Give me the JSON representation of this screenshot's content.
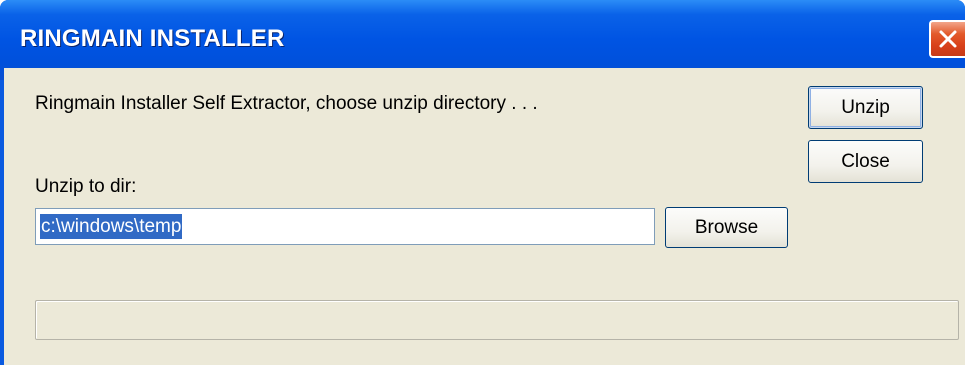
{
  "window": {
    "title": "RINGMAIN INSTALLER"
  },
  "dialog": {
    "message": "Ringmain Installer Self Extractor, choose unzip directory . . .",
    "unzip_to_label": "Unzip to dir:",
    "directory_value": "c:\\windows\\temp",
    "buttons": {
      "unzip": "Unzip",
      "close": "Close",
      "browse": "Browse"
    },
    "progress": 0
  },
  "icons": {
    "close": "close-icon"
  },
  "colors": {
    "titlebar": "#0054e3",
    "client": "#ece9d8",
    "close_button": "#d8401a",
    "selection": "#316ac5"
  }
}
